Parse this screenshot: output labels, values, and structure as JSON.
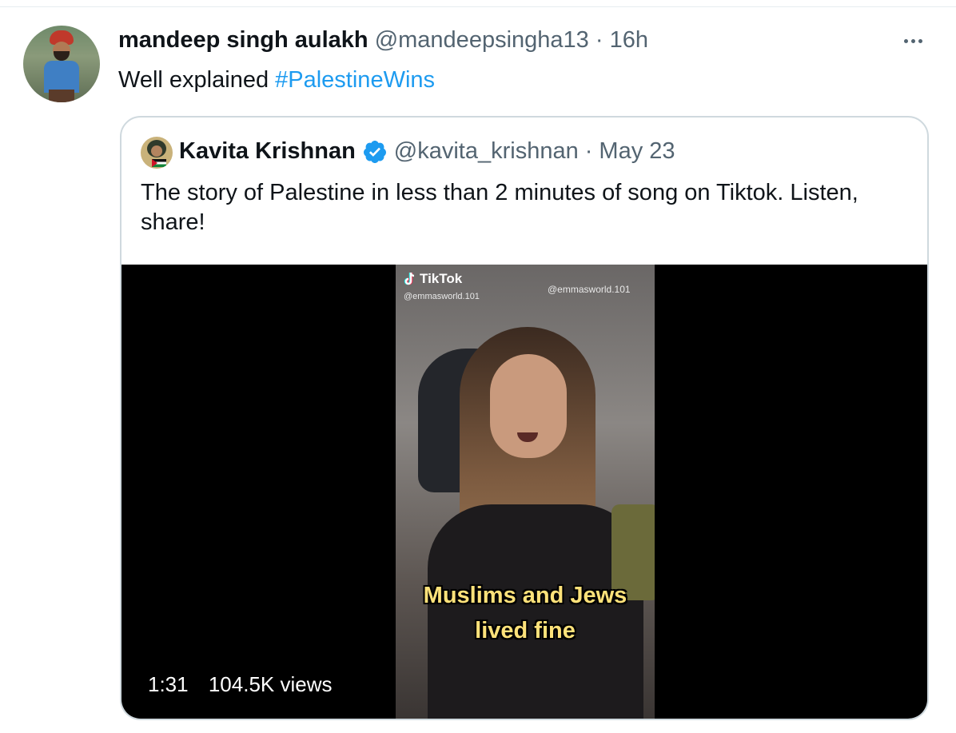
{
  "tweet": {
    "author_name": "mandeep singh aulakh",
    "author_handle": "@mandeepsingha13",
    "separator": "·",
    "time": "16h",
    "text_prefix": "Well explained",
    "hashtag": "#PalestineWins"
  },
  "quoted_tweet": {
    "author_name": "Kavita Krishnan",
    "author_handle": "@kavita_krishnan",
    "separator": "·",
    "date": "May 23",
    "verified": true,
    "text": "The story of Palestine in less than 2 minutes of song on Tiktok. Listen, share!"
  },
  "video": {
    "watermark_logo": "TikTok",
    "watermark_handle": "@emmasworld.101",
    "watermark_handle_2": "@emmasworld.101",
    "caption_line_1": "Muslims and Jews",
    "caption_line_2": "lived fine",
    "duration": "1:31",
    "views": "104.5K views"
  },
  "colors": {
    "link": "#1d9bf0",
    "muted": "#536471",
    "border": "#cfd9de",
    "caption": "#ffe27a"
  },
  "icons": [
    "more-icon",
    "verified-badge-icon",
    "tiktok-logo-icon"
  ]
}
